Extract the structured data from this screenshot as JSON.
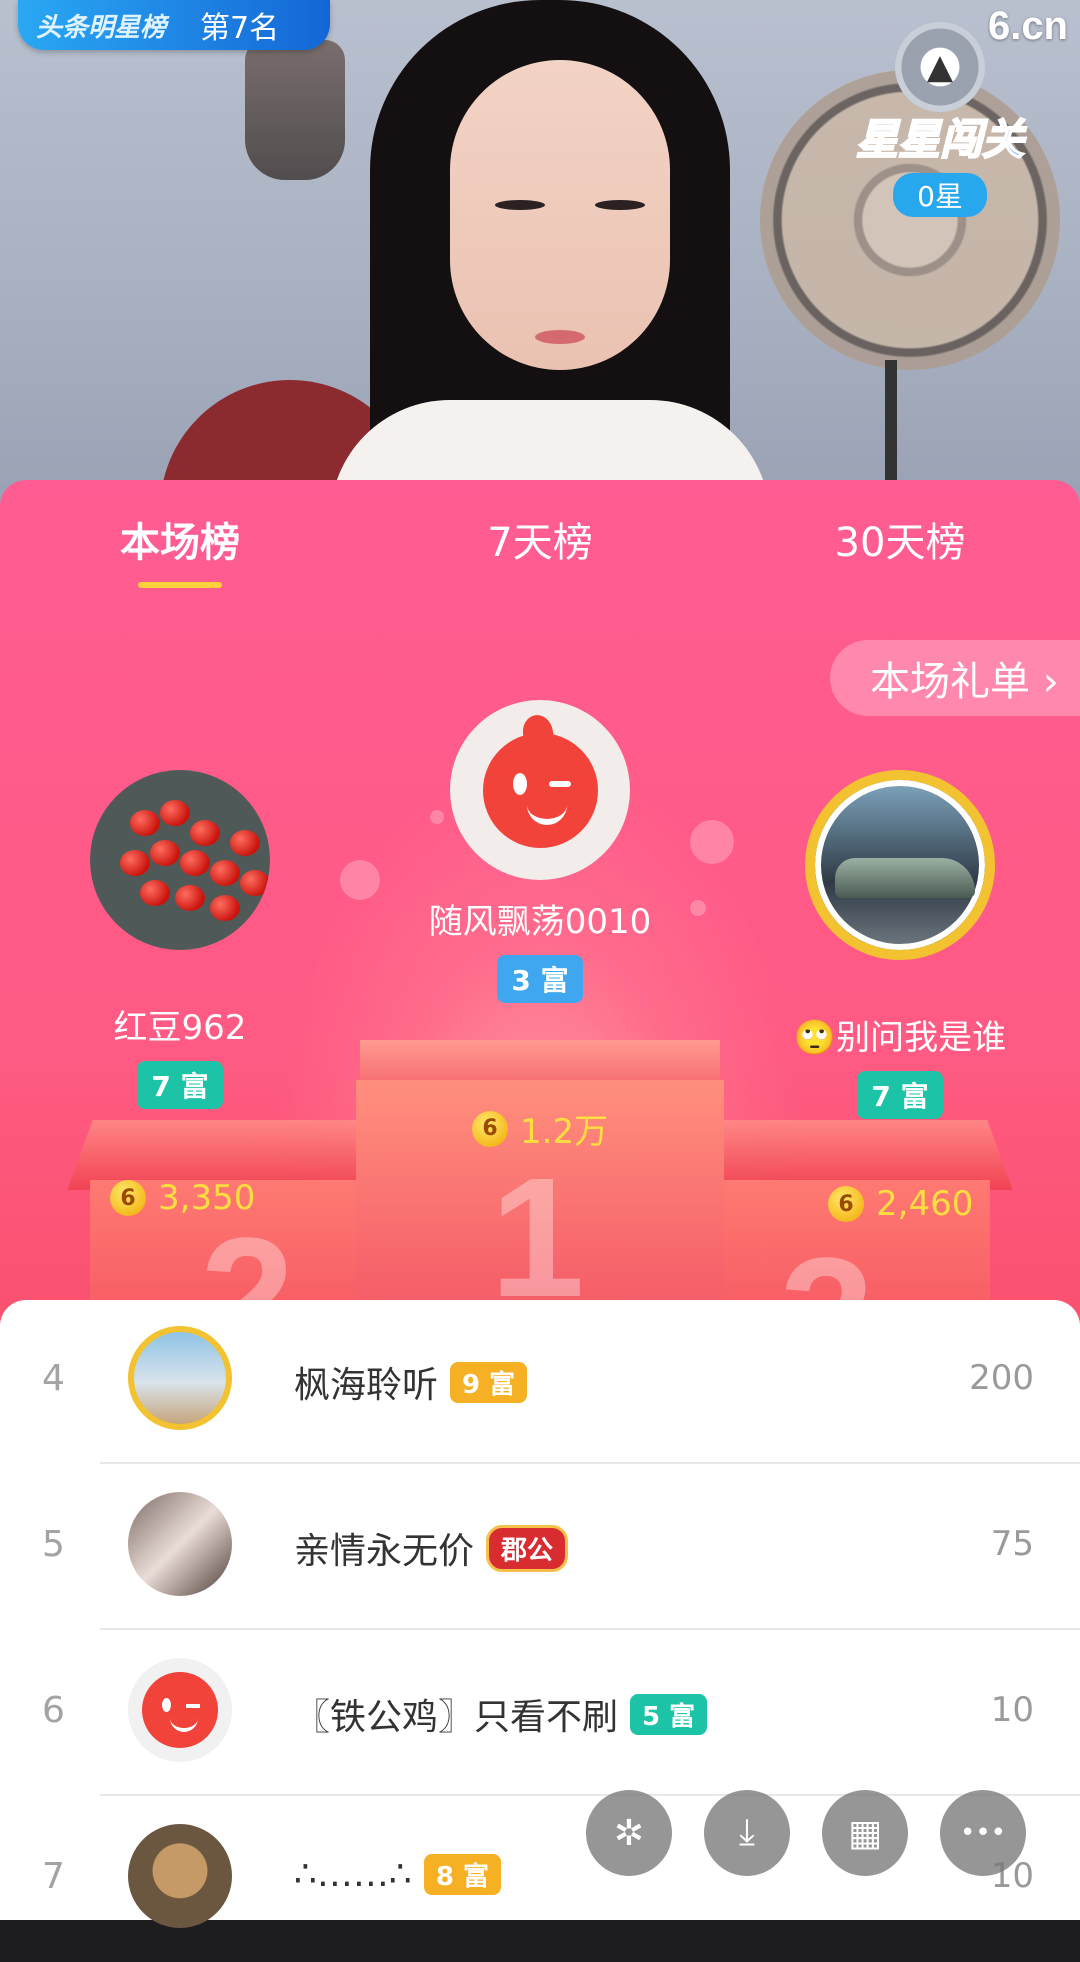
{
  "stream": {
    "rank_badge": {
      "tag": "头条明星榜",
      "position": "第7名"
    },
    "brand_logo": "6.cn",
    "star_gate": {
      "title": "星星闯关",
      "count": "0星"
    }
  },
  "tabs": [
    {
      "label": "本场榜",
      "active": true
    },
    {
      "label": "7天榜",
      "active": false
    },
    {
      "label": "30天榜",
      "active": false
    }
  ],
  "gift_list_button": "本场礼单 ›",
  "podium": {
    "first": {
      "name": "随风飘荡0010",
      "level": "3 富",
      "coins": "1.2万",
      "rank": "1"
    },
    "second": {
      "name": "红豆962",
      "level": "7 富",
      "coins": "3,350",
      "rank": "2"
    },
    "third": {
      "name": "🙄别问我是谁",
      "level": "7 富",
      "coins": "2,460",
      "rank": "3"
    }
  },
  "coin_symbol": "6",
  "list": [
    {
      "rank": "4",
      "name": "枫海聆听",
      "level": "9 富",
      "level_color": "gold",
      "score": "200"
    },
    {
      "rank": "5",
      "name": "亲情永无价",
      "level": "郡公",
      "level_color": "gov",
      "score": "75"
    },
    {
      "rank": "6",
      "name": "〖铁公鸡〗只看不刷",
      "level": "5 富",
      "level_color": "teal",
      "score": "10"
    },
    {
      "rank": "7",
      "name": "∴……∴",
      "level": "8 富",
      "level_color": "gold",
      "score": "10"
    }
  ],
  "fabs": [
    {
      "icon": "sparkle-icon",
      "glyph": "✲"
    },
    {
      "icon": "download-icon",
      "glyph": "⤓"
    },
    {
      "icon": "grid-icon",
      "glyph": "▦"
    },
    {
      "icon": "more-icon",
      "glyph": "•••"
    }
  ],
  "colors": {
    "panel_pink": "#ff5c93",
    "tab_underline": "#ffd13b",
    "coin_text": "#ffde40"
  }
}
